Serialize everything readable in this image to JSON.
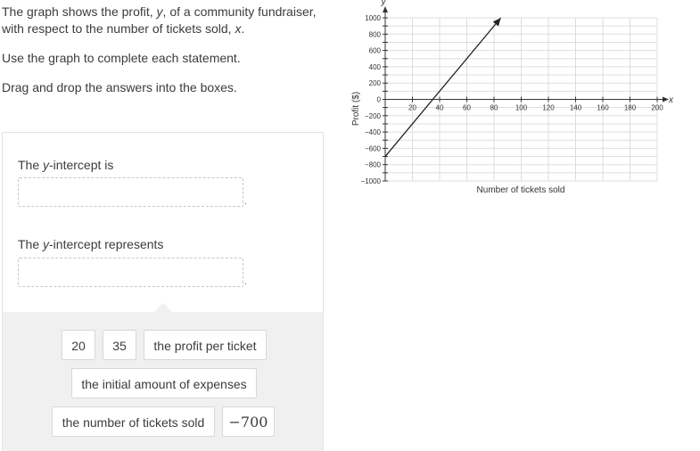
{
  "prompt": {
    "line1_a": "The graph shows the profit, ",
    "line1_var_y": "y",
    "line1_b": ", of a community fundraiser, with respect to the number of tickets sold, ",
    "line1_var_x": "x",
    "line1_c": ".",
    "line2": "Use the graph to complete each statement.",
    "line3": "Drag and drop the answers into the boxes."
  },
  "statements": [
    {
      "pre": "The ",
      "var": "y",
      "post": "-intercept is",
      "value": "",
      "period": "."
    },
    {
      "pre": "The ",
      "var": "y",
      "post": "-intercept represents",
      "value": "",
      "period": "."
    }
  ],
  "answer_choices": [
    {
      "label": "20"
    },
    {
      "label": "35"
    },
    {
      "label": "the profit per ticket"
    },
    {
      "label": "the initial amount of expenses"
    },
    {
      "label": "the number of tickets sold"
    },
    {
      "label": "−700"
    }
  ],
  "chart_data": {
    "type": "line",
    "title": "",
    "xlabel": "Number of tickets sold",
    "ylabel": "Profit ($)",
    "x_axis_var": "x",
    "y_axis_var": "y",
    "xlim": [
      0,
      200
    ],
    "ylim": [
      -1000,
      1000
    ],
    "x_ticks": [
      20,
      40,
      60,
      80,
      100,
      120,
      140,
      160,
      180,
      200
    ],
    "y_ticks": [
      1000,
      800,
      600,
      400,
      200,
      0,
      -200,
      -400,
      -600,
      -800,
      -1000
    ],
    "x_tick_labels": [
      "20",
      "40",
      "60",
      "80",
      "100",
      "120",
      "140",
      "160",
      "180",
      "200"
    ],
    "y_tick_labels": [
      "1000",
      "800",
      "600",
      "400",
      "200",
      "0",
      "−200",
      "−400",
      "−600",
      "−800",
      "−1000"
    ],
    "grid": true,
    "series": [
      {
        "name": "profit",
        "x": [
          0,
          85
        ],
        "y": [
          -700,
          1000
        ],
        "end_arrow": true
      }
    ],
    "colors": {
      "line": "#222222",
      "grid": "#dddddd",
      "axis": "#333333"
    }
  }
}
